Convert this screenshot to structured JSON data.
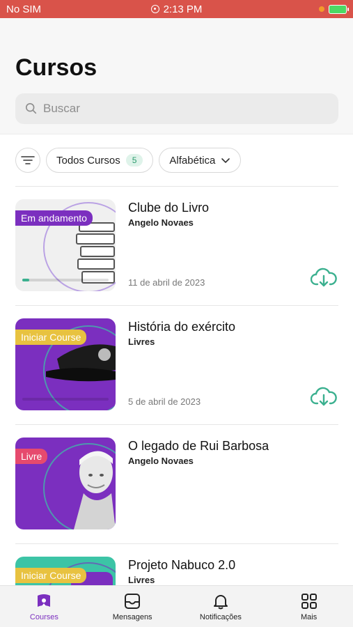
{
  "status_bar": {
    "carrier": "No SIM",
    "time": "2:13 PM"
  },
  "header": {
    "title": "Cursos"
  },
  "search": {
    "placeholder": "Buscar"
  },
  "filters": {
    "all_label": "Todos Cursos",
    "all_count": "5",
    "sort_label": "Alfabética"
  },
  "courses": [
    {
      "title": "Clube do Livro",
      "author": "Angelo Novaes",
      "tag": "Em andamento",
      "date": "11 de abril de 2023",
      "progress": 0.08,
      "tag_color": "#7b2fbf",
      "thumb_bg": "#f0f0f0"
    },
    {
      "title": "História do exército",
      "author": "Livres",
      "tag": "Iniciar Course",
      "date": "5 de abril de 2023",
      "progress": 0,
      "tag_color": "#e8c240",
      "thumb_bg": "#7b2fbf"
    },
    {
      "title": "O legado de Rui Barbosa",
      "author": "Angelo Novaes",
      "tag": "Livre",
      "date": "",
      "progress": 0,
      "tag_color": "#e64a6e",
      "thumb_bg": "#7b2fbf"
    },
    {
      "title": "Projeto Nabuco 2.0",
      "author": "Livres",
      "tag": "Iniciar Course",
      "date": "",
      "progress": 0,
      "tag_color": "#e8c240",
      "thumb_bg": "#3cc4a6"
    }
  ],
  "tabs": [
    {
      "label": "Courses",
      "icon": "courses-icon"
    },
    {
      "label": "Mensagens",
      "icon": "inbox-icon"
    },
    {
      "label": "Notificações",
      "icon": "bell-icon"
    },
    {
      "label": "Mais",
      "icon": "grid-icon"
    }
  ],
  "colors": {
    "accent": "#7b2fbf",
    "status_bar": "#d9534a",
    "download": "#3bb08f"
  }
}
